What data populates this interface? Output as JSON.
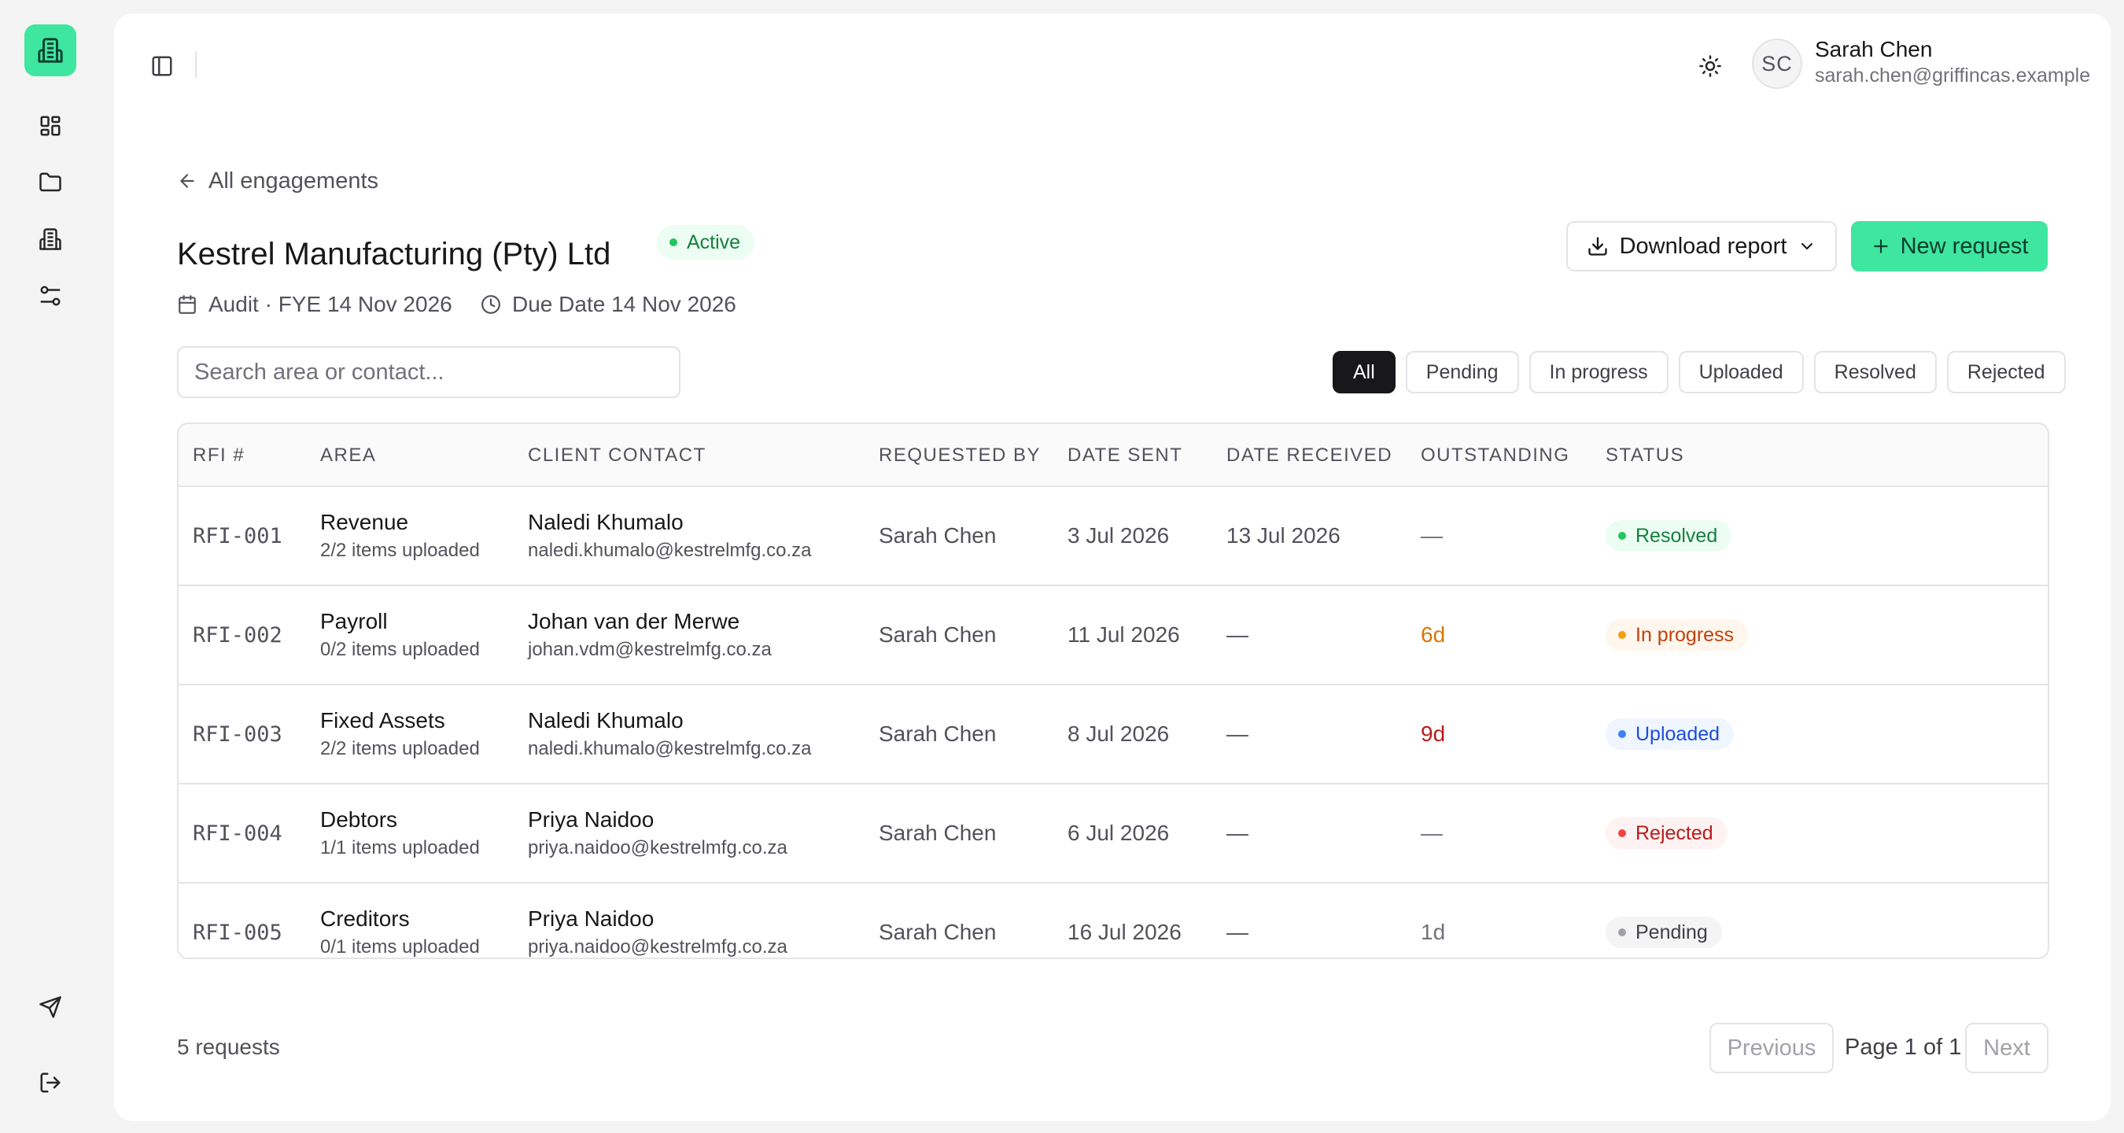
{
  "user": {
    "initials": "SC",
    "name": "Sarah Chen",
    "email": "sarah.chen@griffincas.example"
  },
  "nav": {
    "back_label": "All engagements",
    "items": [
      "dashboard-icon",
      "folder-icon",
      "building-icon",
      "settings-sliders-icon"
    ],
    "bottom": [
      "send-icon",
      "logout-icon"
    ]
  },
  "engagement": {
    "title": "Kestrel Manufacturing (Pty) Ltd",
    "status": "Active",
    "type_fye": "Audit · FYE 14 Nov 2026",
    "due_date": "Due Date 14 Nov 2026"
  },
  "actions": {
    "download_label": "Download report",
    "new_request_label": "New request"
  },
  "search": {
    "placeholder": "Search area or contact..."
  },
  "filters": [
    "All",
    "Pending",
    "In progress",
    "Uploaded",
    "Resolved",
    "Rejected"
  ],
  "active_filter": "All",
  "table": {
    "headers": [
      "RFI #",
      "AREA",
      "CLIENT CONTACT",
      "REQUESTED BY",
      "DATE SENT",
      "DATE RECEIVED",
      "OUTSTANDING",
      "STATUS"
    ],
    "rows": [
      {
        "id": "RFI-001",
        "area": "Revenue",
        "items": "2/2 items uploaded",
        "contact_name": "Naledi Khumalo",
        "contact_email": "naledi.khumalo@kestrelmfg.co.za",
        "requested_by": "Sarah Chen",
        "date_sent": "3 Jul 2026",
        "date_received": "13 Jul 2026",
        "outstanding": "—",
        "status": "Resolved"
      },
      {
        "id": "RFI-002",
        "area": "Payroll",
        "items": "0/2 items uploaded",
        "contact_name": "Johan van der Merwe",
        "contact_email": "johan.vdm@kestrelmfg.co.za",
        "requested_by": "Sarah Chen",
        "date_sent": "11 Jul 2026",
        "date_received": "—",
        "outstanding": "6d",
        "status": "In progress"
      },
      {
        "id": "RFI-003",
        "area": "Fixed Assets",
        "items": "2/2 items uploaded",
        "contact_name": "Naledi Khumalo",
        "contact_email": "naledi.khumalo@kestrelmfg.co.za",
        "requested_by": "Sarah Chen",
        "date_sent": "8 Jul 2026",
        "date_received": "—",
        "outstanding": "9d",
        "status": "Uploaded"
      },
      {
        "id": "RFI-004",
        "area": "Debtors",
        "items": "1/1 items uploaded",
        "contact_name": "Priya Naidoo",
        "contact_email": "priya.naidoo@kestrelmfg.co.za",
        "requested_by": "Sarah Chen",
        "date_sent": "6 Jul 2026",
        "date_received": "—",
        "outstanding": "—",
        "status": "Rejected"
      },
      {
        "id": "RFI-005",
        "area": "Creditors",
        "items": "0/1 items uploaded",
        "contact_name": "Priya Naidoo",
        "contact_email": "priya.naidoo@kestrelmfg.co.za",
        "requested_by": "Sarah Chen",
        "date_sent": "16 Jul 2026",
        "date_received": "—",
        "outstanding": "1d",
        "status": "Pending"
      }
    ]
  },
  "status_colors": {
    "Resolved": {
      "bg": "#ecfdf3",
      "fg": "#15803d",
      "dot": "#22c55e"
    },
    "In progress": {
      "bg": "#fff7ed",
      "fg": "#c2410c",
      "dot": "#f59e0b"
    },
    "Uploaded": {
      "bg": "#eff6ff",
      "fg": "#1d4ed8",
      "dot": "#3b82f6"
    },
    "Rejected": {
      "bg": "#fef2f2",
      "fg": "#b91c1c",
      "dot": "#ef4444"
    },
    "Pending": {
      "bg": "#f4f4f5",
      "fg": "#3f3f46",
      "dot": "#a1a1aa"
    }
  },
  "footer": {
    "count": "5 requests",
    "previous": "Previous",
    "page_info": "Page 1 of 1",
    "next": "Next"
  },
  "colors": {
    "accent": "#3ee6a0"
  }
}
